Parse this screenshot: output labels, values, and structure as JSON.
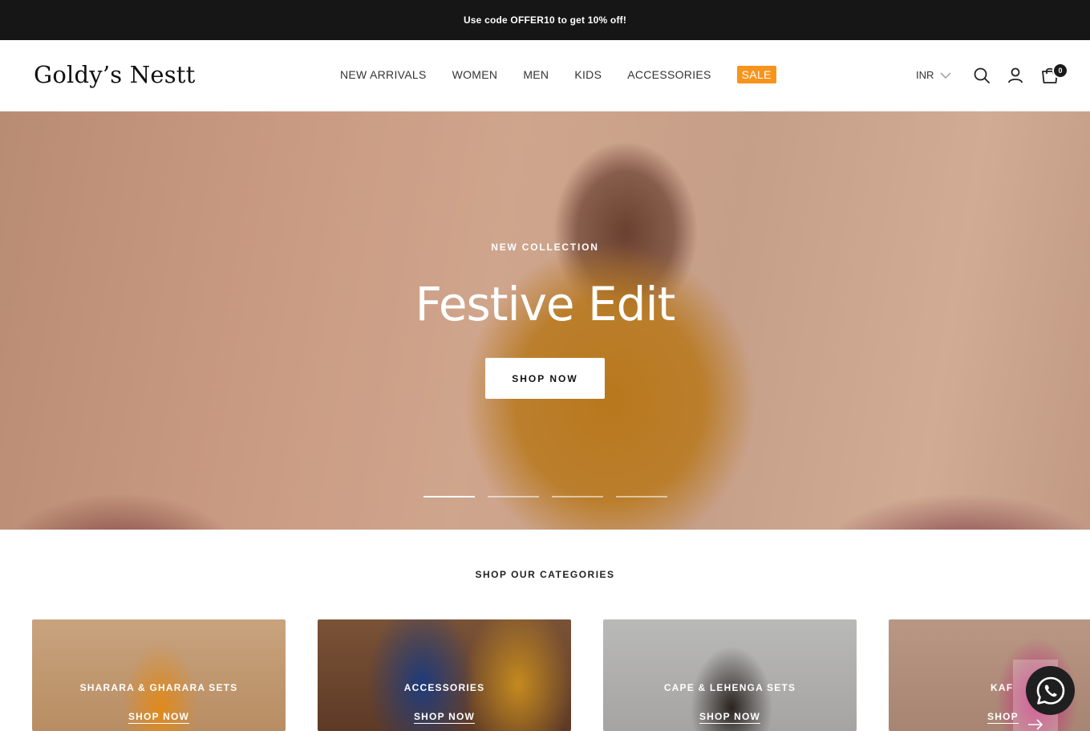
{
  "announcement": {
    "text": "Use code OFFER10 to get 10% off!"
  },
  "header": {
    "logo": "Goldy’s Nestt",
    "nav": [
      {
        "label": "NEW ARRIVALS"
      },
      {
        "label": "WOMEN"
      },
      {
        "label": "MEN"
      },
      {
        "label": "KIDS"
      },
      {
        "label": "ACCESSORIES"
      }
    ],
    "sale_label": "SALE",
    "currency": "INR",
    "cart_count": "0",
    "icons": [
      "search-icon",
      "account-icon",
      "cart-icon",
      "chevron-down-icon"
    ],
    "sale_color": "#f7941d"
  },
  "hero": {
    "subtitle": "NEW COLLECTION",
    "title": "Festive Edit",
    "button": "SHOP NOW",
    "slide_count": 4,
    "active_slide": 1
  },
  "categories": {
    "heading": "SHOP OUR CATEGORIES",
    "items": [
      {
        "title": "SHARARA & GHARARA SETS",
        "link": "SHOP NOW"
      },
      {
        "title": "ACCESSORIES",
        "link": "SHOP NOW"
      },
      {
        "title": "CAPE & LEHENGA SETS",
        "link": "SHOP NOW"
      },
      {
        "title": "KAF",
        "link": "SHOP"
      }
    ]
  },
  "floating": {
    "icons": [
      "whatsapp-icon",
      "arrow-right-icon"
    ]
  }
}
